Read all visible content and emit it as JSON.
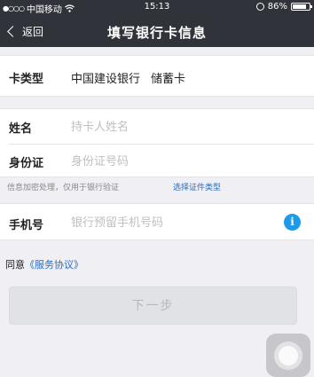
{
  "statusbar": {
    "carrier": "中国移动",
    "signal": "●○○○",
    "wifi_icon": "wifi-icon",
    "time": "15:13",
    "battery": "86%",
    "battery_level": 0.86
  },
  "navbar": {
    "back_label": "返回",
    "title": "填写银行卡信息"
  },
  "card": {
    "label": "卡类型",
    "bank": "中国建设银行",
    "type": "储蓄卡"
  },
  "form": {
    "name_label": "姓名",
    "name_placeholder": "持卡人姓名",
    "id_label": "身份证",
    "id_placeholder": "身份证号码"
  },
  "hint": {
    "text": "信息加密处理，仅用于银行验证",
    "link": "选择证件类型"
  },
  "phone": {
    "label": "手机号",
    "placeholder": "银行预留手机号码",
    "info_symbol": "i"
  },
  "agreement": {
    "prefix": "同意",
    "link": "《服务协议》"
  },
  "buttons": {
    "next_label": "下一步"
  },
  "colors": {
    "header_bg": "#30343a",
    "page_bg": "#efeff4",
    "link": "#2a6ebb",
    "info_icon": "#1e9be8"
  }
}
